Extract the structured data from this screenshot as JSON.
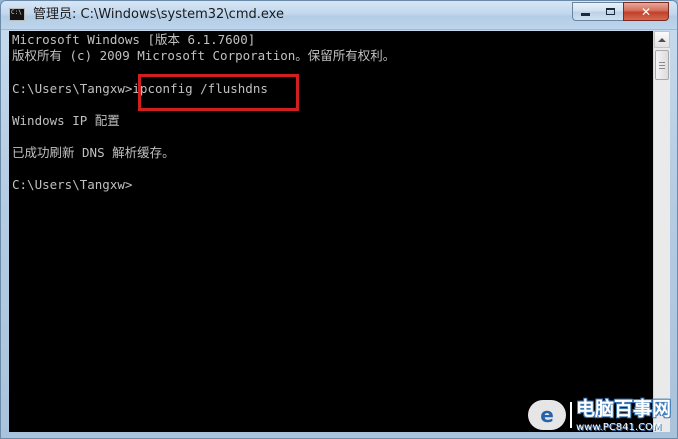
{
  "window": {
    "title": "管理员: C:\\Windows\\system32\\cmd.exe",
    "icon_label": "C:\\",
    "icon": "cmd-icon",
    "buttons": {
      "minimize": "minimize-icon",
      "maximize": "maximize-icon",
      "close": "✕"
    }
  },
  "console": {
    "lines": [
      "Microsoft Windows [版本 6.1.7600]",
      "版权所有 (c) 2009 Microsoft Corporation。保留所有权利。",
      "C:\\Users\\Tangxw>ipconfig /flushdns",
      "Windows IP 配置",
      "已成功刷新 DNS 解析缓存。",
      "C:\\Users\\Tangxw>"
    ],
    "highlight_color": "#d01f1f",
    "text_color": "#c0c0c0",
    "background": "#000000"
  },
  "watermark": {
    "name": "电脑百事网",
    "url": "www.PC841.COM"
  }
}
